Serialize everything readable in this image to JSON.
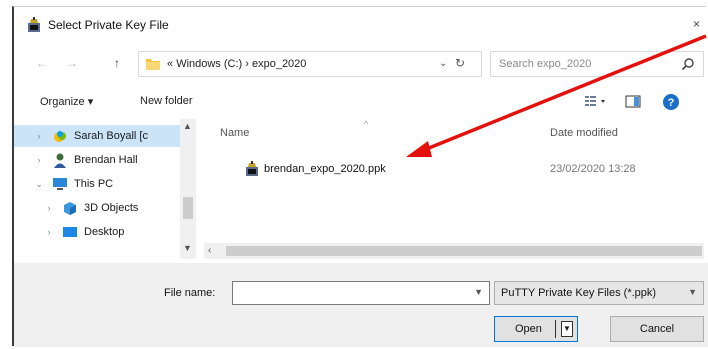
{
  "window": {
    "title": "Select Private Key File",
    "close_glyph": "×"
  },
  "address": {
    "back_glyph": "←",
    "forward_glyph": "→",
    "up_glyph": "↑",
    "path_prefix": "«",
    "path": "Windows (C:)  ›  expo_2020",
    "search_placeholder": "Search expo_2020"
  },
  "toolbar": {
    "organize_label": "Organize ▾",
    "new_folder_label": "New folder"
  },
  "sidebar": {
    "items": [
      {
        "label": "Sarah Boyall [c",
        "icon": "onedrive-icon",
        "selected": true
      },
      {
        "label": "Brendan Hall",
        "icon": "user-icon",
        "selected": false
      },
      {
        "label": "This PC",
        "icon": "pc-icon",
        "selected": false,
        "expanded": true
      },
      {
        "label": "3D Objects",
        "icon": "3d-objects-icon",
        "selected": false
      },
      {
        "label": "Desktop",
        "icon": "desktop-icon",
        "selected": false
      }
    ]
  },
  "file_list": {
    "columns": {
      "name": "Name",
      "date": "Date modified"
    },
    "files": [
      {
        "name": "brendan_expo_2020.ppk",
        "date": "23/02/2020 13:28",
        "icon": "putty-key-icon"
      }
    ]
  },
  "bottom": {
    "filename_label": "File name:",
    "filename_value": "",
    "filetype_selected": "PuTTY Private Key Files (*.ppk)",
    "open_label": "Open",
    "cancel_label": "Cancel"
  },
  "colors": {
    "selection": "#cce4f7",
    "accent": "#0078d7",
    "annotation_arrow": "#e3100c",
    "panel": "#f0f0f0"
  }
}
